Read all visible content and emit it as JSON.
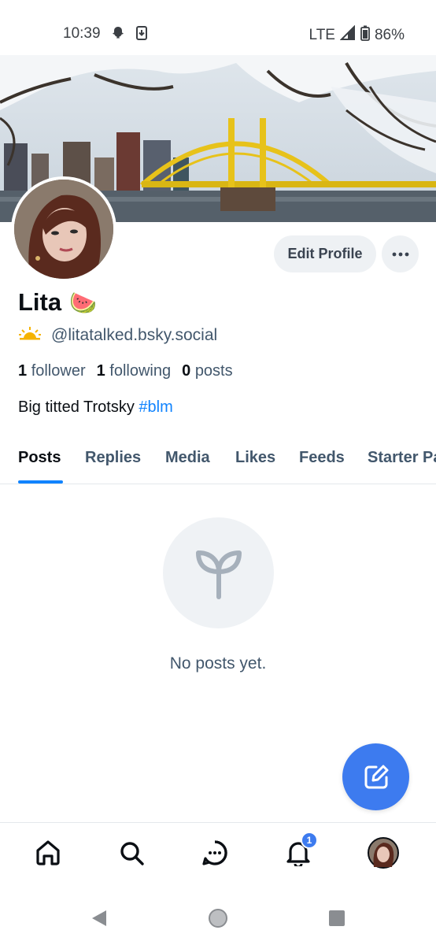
{
  "status_bar": {
    "time": "10:39",
    "network": "LTE",
    "battery": "86%",
    "icons": [
      "snapchat-icon",
      "download-icon",
      "signal-icon",
      "battery-icon"
    ]
  },
  "profile": {
    "display_name": "Lita",
    "name_emoji": "🍉",
    "handle": "@litatalked.bsky.social",
    "followers_count": "1",
    "followers_label": "follower",
    "following_count": "1",
    "following_label": "following",
    "posts_count": "0",
    "posts_label": "posts",
    "bio_text": "Big titted Trotsky ",
    "bio_tag": "#blm"
  },
  "actions": {
    "edit_profile": "Edit Profile",
    "more": "more-options-icon"
  },
  "tabs": [
    {
      "label": "Posts",
      "active": true
    },
    {
      "label": "Replies",
      "active": false
    },
    {
      "label": "Media",
      "active": false
    },
    {
      "label": "Likes",
      "active": false
    },
    {
      "label": "Feeds",
      "active": false
    },
    {
      "label": "Starter Packs",
      "active": false
    }
  ],
  "empty_state": {
    "message": "No posts yet.",
    "icon": "sprout-icon"
  },
  "bottom_nav": {
    "items": [
      "home-icon",
      "search-icon",
      "chat-icon",
      "bell-icon",
      "profile-avatar"
    ],
    "notification_badge": "1"
  },
  "colors": {
    "accent": "#1083fe",
    "fab": "#3d7bef",
    "muted_text": "#42576c",
    "button_bg": "#eef1f4"
  }
}
